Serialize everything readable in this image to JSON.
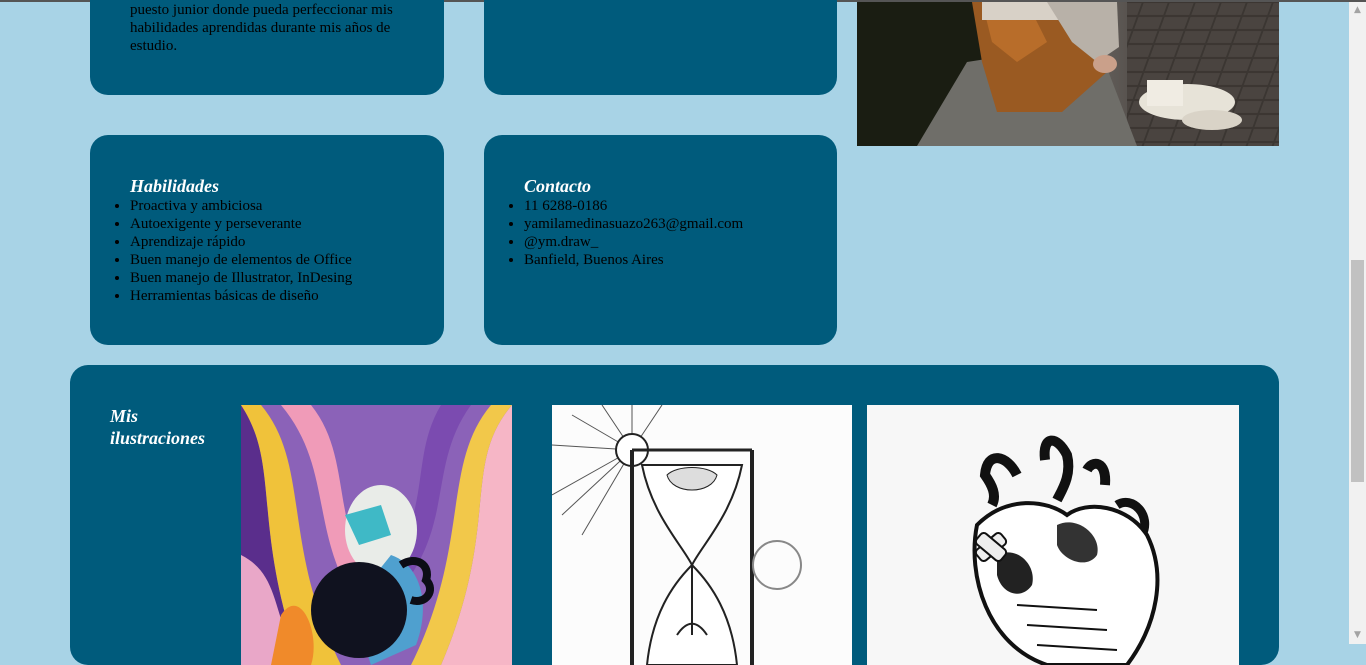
{
  "objective": {
    "text": "puesto junior donde pueda perfeccionar mis habilidades aprendidas durante mis años de estudio."
  },
  "skills": {
    "title": "Habilidades",
    "items": [
      "Proactiva y ambiciosa",
      "Autoexigente y perseverante",
      "Aprendizaje rápido",
      "Buen manejo de elementos de Office",
      "Buen manejo de Illustrator, InDesing",
      "Herramientas básicas de diseño"
    ]
  },
  "contact": {
    "title": "Contacto",
    "items": [
      "11 6288-0186",
      "yamilamedinasuazo263@gmail.com",
      "@ym.draw_",
      "Banfield, Buenos Aires"
    ]
  },
  "gallery": {
    "title": "Mis ilustraciones"
  },
  "colors": {
    "background": "#a8d3e6",
    "card": "#005b7c"
  }
}
